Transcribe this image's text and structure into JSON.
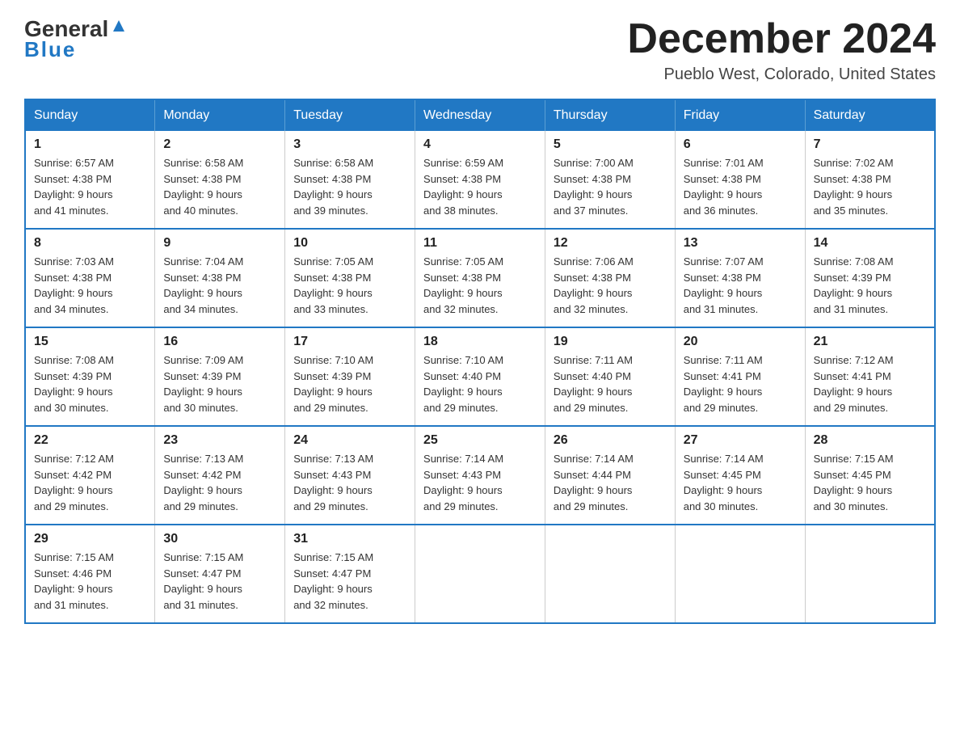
{
  "header": {
    "logo_general": "General",
    "logo_blue": "Blue",
    "title": "December 2024",
    "subtitle": "Pueblo West, Colorado, United States"
  },
  "weekdays": [
    "Sunday",
    "Monday",
    "Tuesday",
    "Wednesday",
    "Thursday",
    "Friday",
    "Saturday"
  ],
  "weeks": [
    [
      {
        "day": "1",
        "sunrise": "6:57 AM",
        "sunset": "4:38 PM",
        "daylight": "9 hours and 41 minutes."
      },
      {
        "day": "2",
        "sunrise": "6:58 AM",
        "sunset": "4:38 PM",
        "daylight": "9 hours and 40 minutes."
      },
      {
        "day": "3",
        "sunrise": "6:58 AM",
        "sunset": "4:38 PM",
        "daylight": "9 hours and 39 minutes."
      },
      {
        "day": "4",
        "sunrise": "6:59 AM",
        "sunset": "4:38 PM",
        "daylight": "9 hours and 38 minutes."
      },
      {
        "day": "5",
        "sunrise": "7:00 AM",
        "sunset": "4:38 PM",
        "daylight": "9 hours and 37 minutes."
      },
      {
        "day": "6",
        "sunrise": "7:01 AM",
        "sunset": "4:38 PM",
        "daylight": "9 hours and 36 minutes."
      },
      {
        "day": "7",
        "sunrise": "7:02 AM",
        "sunset": "4:38 PM",
        "daylight": "9 hours and 35 minutes."
      }
    ],
    [
      {
        "day": "8",
        "sunrise": "7:03 AM",
        "sunset": "4:38 PM",
        "daylight": "9 hours and 34 minutes."
      },
      {
        "day": "9",
        "sunrise": "7:04 AM",
        "sunset": "4:38 PM",
        "daylight": "9 hours and 34 minutes."
      },
      {
        "day": "10",
        "sunrise": "7:05 AM",
        "sunset": "4:38 PM",
        "daylight": "9 hours and 33 minutes."
      },
      {
        "day": "11",
        "sunrise": "7:05 AM",
        "sunset": "4:38 PM",
        "daylight": "9 hours and 32 minutes."
      },
      {
        "day": "12",
        "sunrise": "7:06 AM",
        "sunset": "4:38 PM",
        "daylight": "9 hours and 32 minutes."
      },
      {
        "day": "13",
        "sunrise": "7:07 AM",
        "sunset": "4:38 PM",
        "daylight": "9 hours and 31 minutes."
      },
      {
        "day": "14",
        "sunrise": "7:08 AM",
        "sunset": "4:39 PM",
        "daylight": "9 hours and 31 minutes."
      }
    ],
    [
      {
        "day": "15",
        "sunrise": "7:08 AM",
        "sunset": "4:39 PM",
        "daylight": "9 hours and 30 minutes."
      },
      {
        "day": "16",
        "sunrise": "7:09 AM",
        "sunset": "4:39 PM",
        "daylight": "9 hours and 30 minutes."
      },
      {
        "day": "17",
        "sunrise": "7:10 AM",
        "sunset": "4:39 PM",
        "daylight": "9 hours and 29 minutes."
      },
      {
        "day": "18",
        "sunrise": "7:10 AM",
        "sunset": "4:40 PM",
        "daylight": "9 hours and 29 minutes."
      },
      {
        "day": "19",
        "sunrise": "7:11 AM",
        "sunset": "4:40 PM",
        "daylight": "9 hours and 29 minutes."
      },
      {
        "day": "20",
        "sunrise": "7:11 AM",
        "sunset": "4:41 PM",
        "daylight": "9 hours and 29 minutes."
      },
      {
        "day": "21",
        "sunrise": "7:12 AM",
        "sunset": "4:41 PM",
        "daylight": "9 hours and 29 minutes."
      }
    ],
    [
      {
        "day": "22",
        "sunrise": "7:12 AM",
        "sunset": "4:42 PM",
        "daylight": "9 hours and 29 minutes."
      },
      {
        "day": "23",
        "sunrise": "7:13 AM",
        "sunset": "4:42 PM",
        "daylight": "9 hours and 29 minutes."
      },
      {
        "day": "24",
        "sunrise": "7:13 AM",
        "sunset": "4:43 PM",
        "daylight": "9 hours and 29 minutes."
      },
      {
        "day": "25",
        "sunrise": "7:14 AM",
        "sunset": "4:43 PM",
        "daylight": "9 hours and 29 minutes."
      },
      {
        "day": "26",
        "sunrise": "7:14 AM",
        "sunset": "4:44 PM",
        "daylight": "9 hours and 29 minutes."
      },
      {
        "day": "27",
        "sunrise": "7:14 AM",
        "sunset": "4:45 PM",
        "daylight": "9 hours and 30 minutes."
      },
      {
        "day": "28",
        "sunrise": "7:15 AM",
        "sunset": "4:45 PM",
        "daylight": "9 hours and 30 minutes."
      }
    ],
    [
      {
        "day": "29",
        "sunrise": "7:15 AM",
        "sunset": "4:46 PM",
        "daylight": "9 hours and 31 minutes."
      },
      {
        "day": "30",
        "sunrise": "7:15 AM",
        "sunset": "4:47 PM",
        "daylight": "9 hours and 31 minutes."
      },
      {
        "day": "31",
        "sunrise": "7:15 AM",
        "sunset": "4:47 PM",
        "daylight": "9 hours and 32 minutes."
      },
      null,
      null,
      null,
      null
    ]
  ],
  "labels": {
    "sunrise": "Sunrise:",
    "sunset": "Sunset:",
    "daylight": "Daylight:"
  }
}
